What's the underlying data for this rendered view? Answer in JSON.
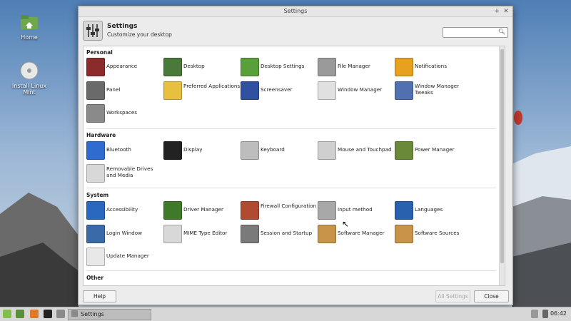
{
  "desktop": {
    "icons": [
      {
        "label": "Home",
        "icon": "folder-home-icon"
      },
      {
        "label": "Install Linux Mint",
        "icon": "disc-icon"
      }
    ]
  },
  "window": {
    "title": "Settings",
    "header_title": "Settings",
    "header_subtitle": "Customize your desktop",
    "search_placeholder": ""
  },
  "sections": {
    "personal": "Personal",
    "hardware": "Hardware",
    "system": "System",
    "other": "Other"
  },
  "personal": [
    {
      "label": "Appearance",
      "icon": "appearance-icon",
      "color": "#8b2b2b"
    },
    {
      "label": "Desktop",
      "icon": "desktop-icon",
      "color": "#4a7a3a"
    },
    {
      "label": "Desktop Settings",
      "icon": "desktop-settings-icon",
      "color": "#5aa03a"
    },
    {
      "label": "File Manager",
      "icon": "file-manager-icon",
      "color": "#9a9a9a"
    },
    {
      "label": "Notifications",
      "icon": "notifications-icon",
      "color": "#e8a020"
    },
    {
      "label": "Panel",
      "icon": "panel-icon",
      "color": "#6a6a6a"
    },
    {
      "label": "Preferred Applications",
      "icon": "preferred-apps-icon",
      "color": "#e8c040"
    },
    {
      "label": "Screensaver",
      "icon": "screensaver-icon",
      "color": "#3050a0"
    },
    {
      "label": "Window Manager",
      "icon": "window-manager-icon",
      "color": "#e0e0e0"
    },
    {
      "label": "Window Manager Tweaks",
      "icon": "wm-tweaks-icon",
      "color": "#5070b0"
    },
    {
      "label": "Workspaces",
      "icon": "workspaces-icon",
      "color": "#8a8a8a"
    }
  ],
  "hardware": [
    {
      "label": "Bluetooth",
      "icon": "bluetooth-icon",
      "color": "#2f6ccf"
    },
    {
      "label": "Display",
      "icon": "display-icon",
      "color": "#222222"
    },
    {
      "label": "Keyboard",
      "icon": "keyboard-icon",
      "color": "#bdbdbd"
    },
    {
      "label": "Mouse and Touchpad",
      "icon": "mouse-icon",
      "color": "#cfcfcf"
    },
    {
      "label": "Power Manager",
      "icon": "power-manager-icon",
      "color": "#6a8a3a"
    },
    {
      "label": "Removable Drives and Media",
      "icon": "removable-drive-icon",
      "color": "#d8d8d8"
    }
  ],
  "system": [
    {
      "label": "Accessibility",
      "icon": "accessibility-icon",
      "color": "#2a68c0"
    },
    {
      "label": "Driver Manager",
      "icon": "driver-manager-icon",
      "color": "#3f7a2a"
    },
    {
      "label": "Firewall Configuration",
      "icon": "firewall-icon",
      "color": "#b04a30"
    },
    {
      "label": "Input method",
      "icon": "input-method-icon",
      "color": "#a8a8a8"
    },
    {
      "label": "Languages",
      "icon": "languages-icon",
      "color": "#2a60b0"
    },
    {
      "label": "Login Window",
      "icon": "login-window-icon",
      "color": "#3a6aa8"
    },
    {
      "label": "MIME Type Editor",
      "icon": "mime-type-icon",
      "color": "#d8d8d8"
    },
    {
      "label": "Session and Startup",
      "icon": "session-startup-icon",
      "color": "#7a7a7a"
    },
    {
      "label": "Software Manager",
      "icon": "software-manager-icon",
      "color": "#c8944a"
    },
    {
      "label": "Software Sources",
      "icon": "software-sources-icon",
      "color": "#c8944a"
    },
    {
      "label": "Update Manager",
      "icon": "update-manager-icon",
      "color": "#e8e8e8"
    }
  ],
  "footer": {
    "help": "Help",
    "all_settings": "All Settings",
    "close": "Close"
  },
  "taskbar": {
    "window_label": "Settings",
    "clock": "06:42"
  }
}
